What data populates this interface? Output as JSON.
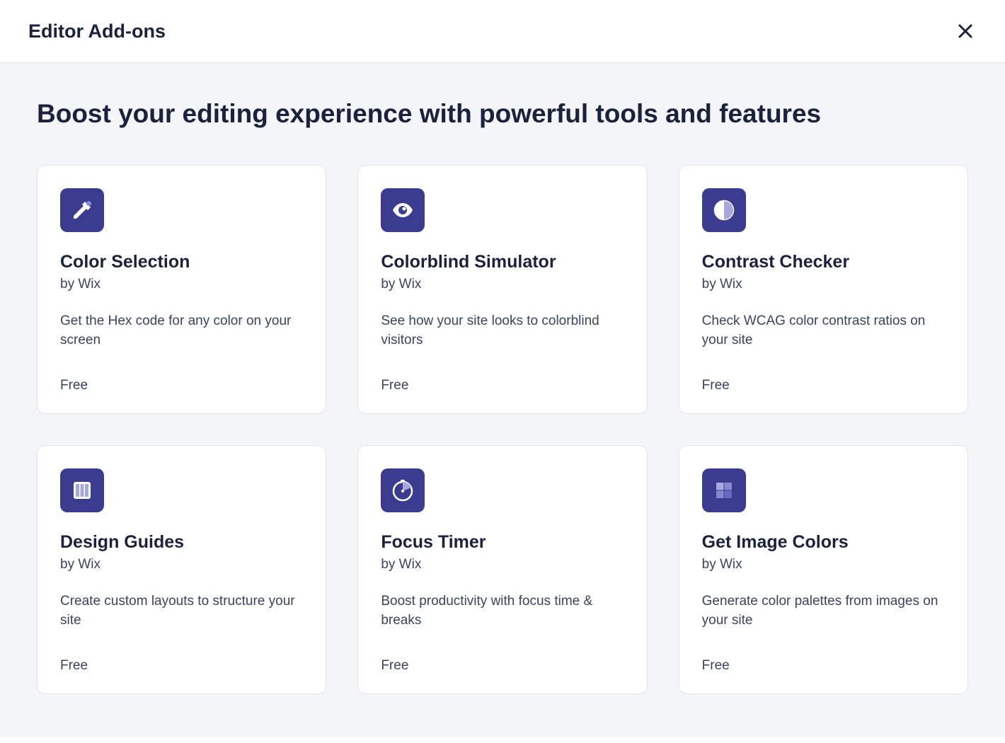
{
  "header": {
    "title": "Editor Add-ons"
  },
  "headline": "Boost your editing experience with powerful tools and features",
  "cards": [
    {
      "icon": "eyedropper-icon",
      "title": "Color Selection",
      "author": "by Wix",
      "desc": "Get the Hex code for any color on your screen",
      "price": "Free"
    },
    {
      "icon": "eye-icon",
      "title": "Colorblind Simulator",
      "author": "by Wix",
      "desc": "See how your site looks to colorblind visitors",
      "price": "Free"
    },
    {
      "icon": "contrast-icon",
      "title": "Contrast Checker",
      "author": "by Wix",
      "desc": "Check WCAG color contrast ratios on your site",
      "price": "Free"
    },
    {
      "icon": "columns-icon",
      "title": "Design Guides",
      "author": "by Wix",
      "desc": "Create custom layouts to structure your site",
      "price": "Free"
    },
    {
      "icon": "timer-icon",
      "title": "Focus Timer",
      "author": "by Wix",
      "desc": "Boost productivity with focus time & breaks",
      "price": "Free"
    },
    {
      "icon": "palette-icon",
      "title": "Get Image Colors",
      "author": "by Wix",
      "desc": "Generate color palettes from images on your site",
      "price": "Free"
    }
  ]
}
